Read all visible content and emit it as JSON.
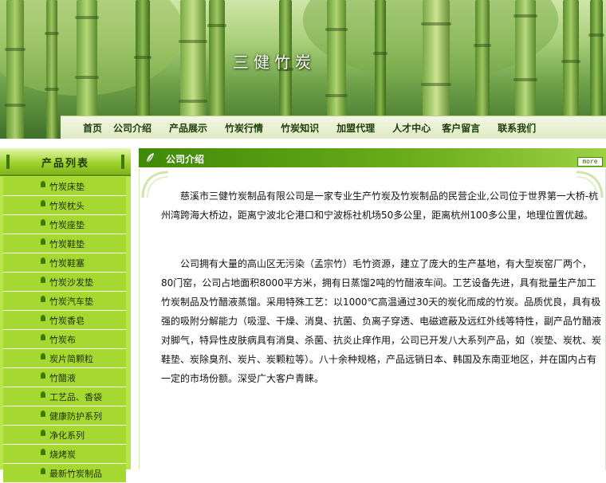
{
  "site": {
    "title": "三健竹炭"
  },
  "nav": {
    "items": [
      "首页",
      "公司介绍",
      "产品展示",
      "竹炭行情",
      "竹炭知识",
      "加盟代理",
      "人才中心",
      "客户留言",
      "联系我们"
    ]
  },
  "sidebar": {
    "title": "产品列表",
    "items": [
      "竹炭床垫",
      "竹炭枕头",
      "竹炭座垫",
      "竹炭鞋垫",
      "竹炭鞋塞",
      "竹炭沙发垫",
      "竹炭汽车垫",
      "竹炭香皂",
      "竹炭布",
      "炭片简颗粒",
      "竹醋液",
      "工艺品、香袋",
      "健康防护系列",
      "净化系列",
      "烧烤炭",
      "最新竹炭制品"
    ]
  },
  "content": {
    "title": "公司介绍",
    "more": "more",
    "paragraphs": [
      "慈溪市三健竹炭制品有限公司是一家专业生产竹炭及竹炭制品的民营企业,公司位于世界第一大桥-杭州湾跨海大桥边，距离宁波北仑港口和宁波栎社机场50多公里，距离杭州100多公里，地理位置优越。",
      "公司拥有大量的高山区无污染（孟宗竹）毛竹资源，建立了庞大的生产基地，有大型炭窑厂两个，80门窑，公司占地面积8000平方米，拥有日蒸馏2吨的竹醋液车间。工艺设备先进，具有批量生产加工竹炭制品及竹醋液蒸馏。采用特殊工艺：以1000℃高温通过30天的炭化而成的竹炭。品质优良，具有极强的吸附分解能力（吸湿、干燥、消臭、抗菌、负离子穿透、电磁遮蔽及远红外线等特性，副产品竹醋液对脚气，特异性皮肤病具有消臭、杀菌、抗炎止痒作用，公司已开发八大系列产品，如（炭垫、炭枕、炭鞋垫、炭除臭剂、炭片、炭颗粒等）。八十余种规格，产品远销日本、韩国及东南亚地区，并在国内占有一定的市场份额。深受广大客户青睐。"
    ]
  },
  "colors": {
    "accent": "#3f8a06",
    "sidebar": "#b8e64a",
    "nav_text": "#1d3d06"
  }
}
